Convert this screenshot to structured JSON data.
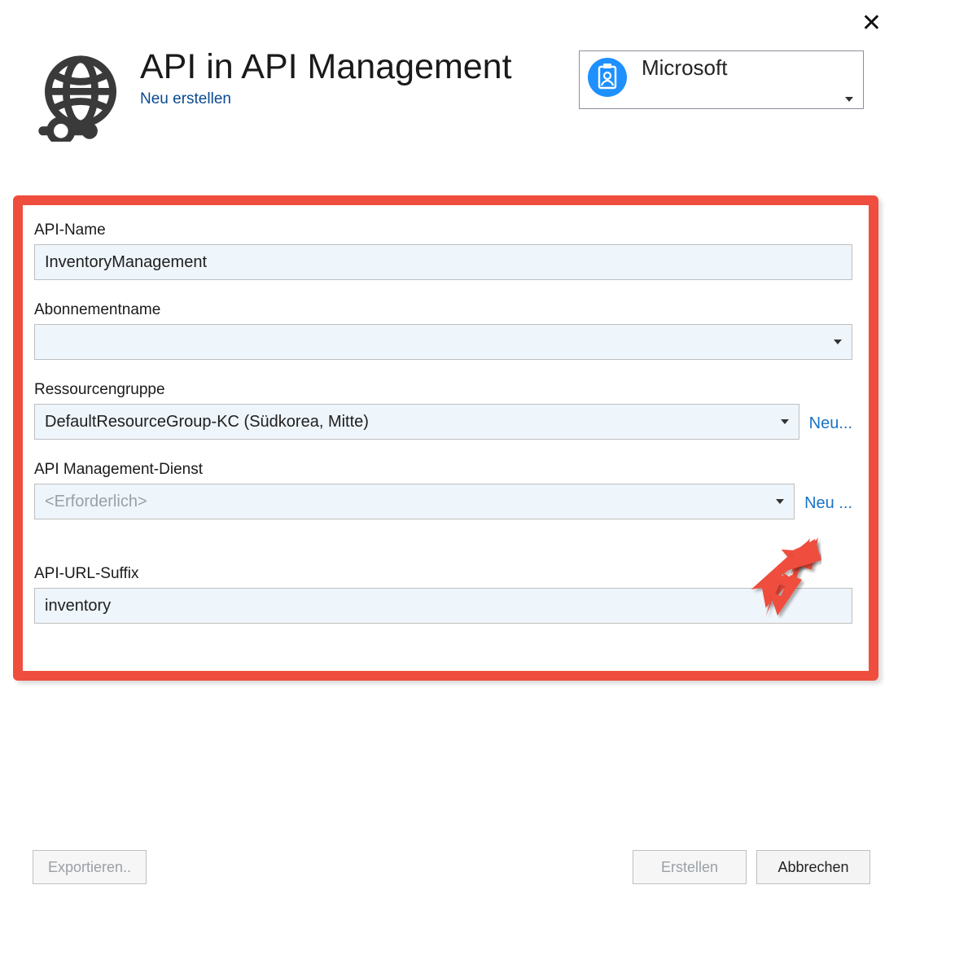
{
  "header": {
    "title": "API in API Management",
    "subtitle": "Neu erstellen"
  },
  "account": {
    "label": "Microsoft",
    "icon": "person-badge-icon"
  },
  "form": {
    "api_name": {
      "label": "API-Name",
      "value": "InventoryManagement"
    },
    "subscription": {
      "label": "Abonnementname",
      "value": ""
    },
    "resource_group": {
      "label": "Ressourcengruppe",
      "value": "DefaultResourceGroup-KC (Südkorea, Mitte)",
      "new_link": "Neu..."
    },
    "apim_service": {
      "label": "API Management-Dienst",
      "placeholder": "<Erforderlich>",
      "value": "",
      "new_link": "Neu ..."
    },
    "url_suffix": {
      "label": "API-URL-Suffix",
      "value": "inventory"
    }
  },
  "footer": {
    "export": "Exportieren..",
    "create": "Erstellen",
    "cancel": "Abbrechen"
  },
  "colors": {
    "highlight": "#ef4e3e",
    "link": "#1a73c7",
    "input_bg": "#eef5fb"
  }
}
